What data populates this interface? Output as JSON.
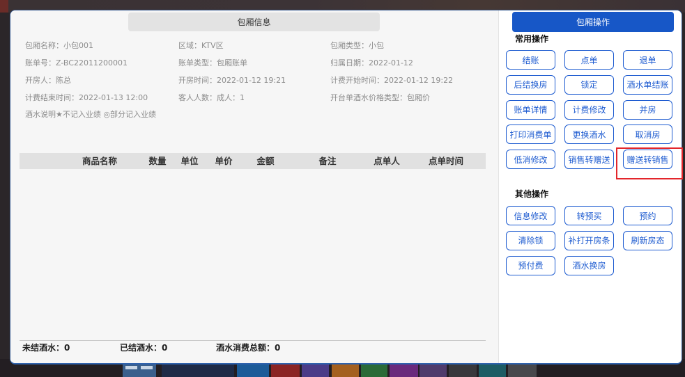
{
  "dialog": {
    "info_title": "包厢信息",
    "room_info": {
      "room_name": {
        "label": "包厢名称：",
        "value": "小包001"
      },
      "area": {
        "label": "区域：",
        "value": "KTV区"
      },
      "room_type": {
        "label": "包厢类型：",
        "value": "小包"
      },
      "bill_no": {
        "label": "账单号：",
        "value": "Z-BC22011200001"
      },
      "bill_type": {
        "label": "账单类型：",
        "value": "包厢账单"
      },
      "business_date": {
        "label": "归属日期：",
        "value": "2022-01-12"
      },
      "opened_by": {
        "label": "开房人：",
        "value": "陈总"
      },
      "open_time": {
        "label": "开房时间：",
        "value": "2022-01-12 19:21"
      },
      "billing_start": {
        "label": "计费开始时间：",
        "value": "2022-01-12 19:22"
      },
      "billing_end": {
        "label": "计费结束时间：",
        "value": "2022-01-13 12:00"
      },
      "guests": {
        "label": "客人人数：",
        "value": "成人：1"
      },
      "price_type": {
        "label": "开台单酒水价格类型：",
        "value": "包厢价"
      }
    },
    "drink_note": "酒水说明★不记入业绩 ◎部分记入业绩",
    "order_table": {
      "columns": [
        "商品名称",
        "数量",
        "单位",
        "单价",
        "金额",
        "备注",
        "点单人",
        "点单时间"
      ],
      "rows": []
    },
    "footer": {
      "unsettled": {
        "label": "未结酒水：",
        "value": "0"
      },
      "settled": {
        "label": "已结酒水：",
        "value": "0"
      },
      "total": {
        "label": "酒水消费总额：",
        "value": "0"
      }
    }
  },
  "actions": {
    "title": "包厢操作",
    "common_label": "常用操作",
    "common": [
      "结账",
      "点单",
      "退单",
      "后结换房",
      "锁定",
      "酒水单结账",
      "账单详情",
      "计费修改",
      "并房",
      "打印消费单",
      "更换酒水",
      "取消房",
      "低消修改",
      "销售转赠送",
      "赠送转销售"
    ],
    "other_label": "其他操作",
    "other": [
      "信息修改",
      "转预买",
      "预约",
      "清除锁",
      "补打开房条",
      "刷新房态",
      "预付费",
      "酒水换房"
    ],
    "highlighted_common_index": 14
  },
  "taskbar": {
    "icon": "menu-icon",
    "tabs": [
      {
        "color": "#1f2b47"
      },
      {
        "color": "#1c5b98"
      },
      {
        "color": "#8b2424"
      },
      {
        "color": "#4b3c88"
      },
      {
        "color": "#a4601f"
      },
      {
        "color": "#2a6b37"
      },
      {
        "color": "#6a2a7c"
      },
      {
        "color": "#4f3b6c"
      },
      {
        "color": "#38383c"
      },
      {
        "color": "#1d5c64"
      },
      {
        "color": "#48484c"
      }
    ]
  },
  "colors": {
    "accent": "#1d5bd0",
    "accent_fill": "#1757c7",
    "highlight": "#e3262b",
    "info_text": "#8c8c8c"
  }
}
